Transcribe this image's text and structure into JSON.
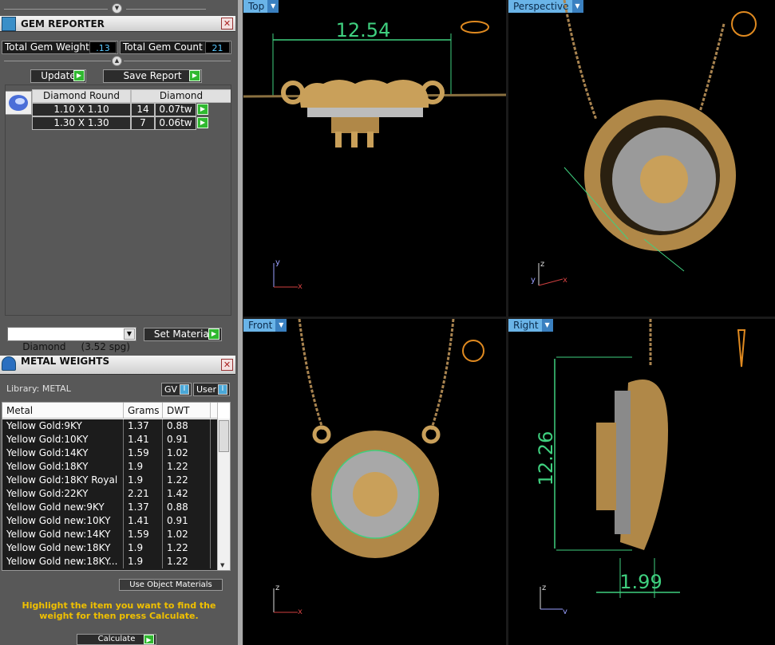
{
  "gem_reporter": {
    "title": "GEM REPORTER",
    "total_gem_weight_label": "Total Gem Weight",
    "total_gem_weight_value": ".13",
    "total_gem_count_label": "Total Gem Count",
    "total_gem_count_value": "21",
    "update_label": "Update",
    "save_report_label": "Save Report",
    "table_header_shape": "Diamond Round",
    "table_header_type": "Diamond",
    "rows": [
      {
        "size": "1.10 X 1.10",
        "count": "14",
        "weight": "0.07tw"
      },
      {
        "size": "1.30 X 1.30",
        "count": "7",
        "weight": "0.06tw"
      }
    ],
    "material_select": "Diamond     (3.52 spg)",
    "set_material_label": "Set Material"
  },
  "metal_weights": {
    "title": "METAL WEIGHTS",
    "library_label": "Library: METAL",
    "gv_label": "GV",
    "user_label": "User",
    "columns": [
      "Metal",
      "Grams",
      "DWT"
    ],
    "rows": [
      {
        "metal": "Yellow Gold:9KY",
        "grams": "1.37",
        "dwt": "0.88"
      },
      {
        "metal": "Yellow Gold:10KY",
        "grams": "1.41",
        "dwt": "0.91"
      },
      {
        "metal": "Yellow Gold:14KY",
        "grams": "1.59",
        "dwt": "1.02"
      },
      {
        "metal": "Yellow Gold:18KY",
        "grams": "1.9",
        "dwt": "1.22"
      },
      {
        "metal": "Yellow Gold:18KY Royal",
        "grams": "1.9",
        "dwt": "1.22"
      },
      {
        "metal": "Yellow Gold:22KY",
        "grams": "2.21",
        "dwt": "1.42"
      },
      {
        "metal": "Yellow Gold new:9KY",
        "grams": "1.37",
        "dwt": "0.88"
      },
      {
        "metal": "Yellow Gold new:10KY",
        "grams": "1.41",
        "dwt": "0.91"
      },
      {
        "metal": "Yellow Gold new:14KY",
        "grams": "1.59",
        "dwt": "1.02"
      },
      {
        "metal": "Yellow Gold new:18KY",
        "grams": "1.9",
        "dwt": "1.22"
      },
      {
        "metal": "Yellow Gold new:18KY...",
        "grams": "1.9",
        "dwt": "1.22"
      }
    ],
    "use_object_materials_label": "Use Object Materials",
    "hint_text": "Highlight the item you want to find the weight for then press Calculate.",
    "calculate_label": "Calculate"
  },
  "viewports": {
    "top": {
      "label": "Top",
      "dimension": "12.54"
    },
    "perspective": {
      "label": "Perspective"
    },
    "front": {
      "label": "Front"
    },
    "right": {
      "label": "Right",
      "dimension_height": "12.26",
      "dimension_width": "1.99"
    }
  },
  "axes": {
    "x": "x",
    "y": "y",
    "z": "z"
  },
  "colors": {
    "gold": "#c9a05a",
    "dimension_green": "#3fd07f",
    "hint_yellow": "#f0c000",
    "viewport_label": "#6ab4e8"
  }
}
